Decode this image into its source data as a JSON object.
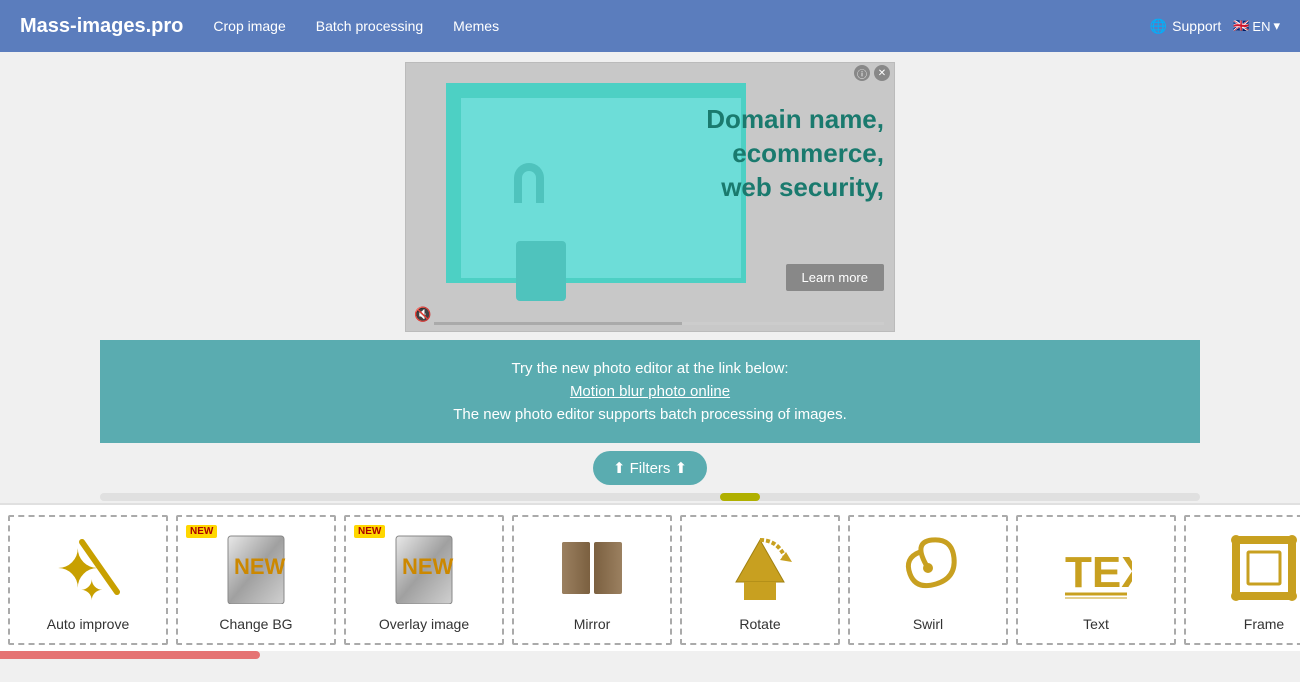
{
  "navbar": {
    "brand": "Mass-images.pro",
    "links": [
      "Crop image",
      "Batch processing",
      "Memes"
    ],
    "support_label": "Support",
    "language": "EN",
    "language_flag": "🇬🇧"
  },
  "ad": {
    "headline": "Domain name,\necommerce,\nweb security,",
    "learn_more_label": "Learn more",
    "info_label": "ⓘ",
    "close_label": "✕"
  },
  "info_bar": {
    "line1": "Try the new photo editor at the link below:",
    "link_label": "Motion blur photo online",
    "line2": "The new photo editor supports batch processing of images."
  },
  "filters": {
    "label": "⬆ Filters ⬆"
  },
  "tools": [
    {
      "id": "auto-improve",
      "label": "Auto improve",
      "icon": "✨",
      "new": false
    },
    {
      "id": "change-bg",
      "label": "Change BG",
      "icon": "📄",
      "new": true
    },
    {
      "id": "overlay-image",
      "label": "Overlay image",
      "icon": "📄",
      "new": true
    },
    {
      "id": "mirror",
      "label": "Mirror",
      "icon": "🪞",
      "new": false
    },
    {
      "id": "rotate",
      "label": "Rotate",
      "icon": "🏠",
      "new": false
    },
    {
      "id": "swirl",
      "label": "Swirl",
      "icon": "🌀",
      "new": false
    },
    {
      "id": "text",
      "label": "Text",
      "icon": "🔤",
      "new": false
    },
    {
      "id": "frame",
      "label": "Frame",
      "icon": "🖼️",
      "new": false
    }
  ]
}
